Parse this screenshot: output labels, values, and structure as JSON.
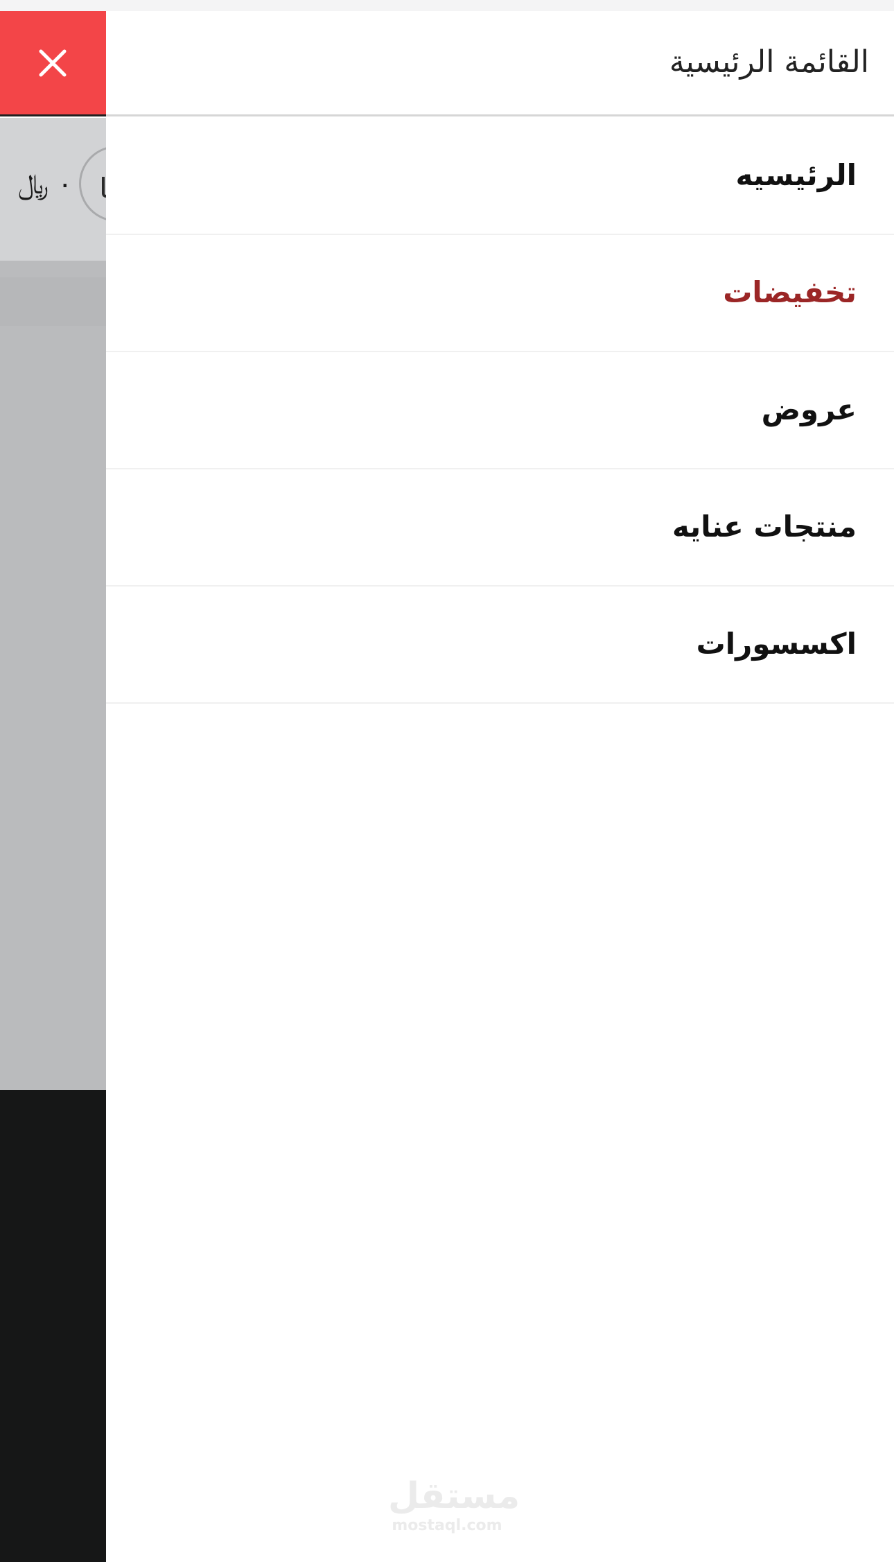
{
  "drawer": {
    "title": "القائمة الرئيسية",
    "close_icon": "close-icon",
    "close_color": "#f34548",
    "items": [
      {
        "label": "الرئيسيه",
        "highlighted": false
      },
      {
        "label": "تخفيضات",
        "highlighted": true
      },
      {
        "label": "عروض",
        "highlighted": false
      },
      {
        "label": "منتجات عنايه",
        "highlighted": false
      },
      {
        "label": "اكسسورات",
        "highlighted": false
      }
    ],
    "highlight_color": "#9b2626"
  },
  "background": {
    "cart_amount": "٠ ﷼",
    "cart_icon": "cart-icon"
  },
  "watermark": {
    "arabic": "مستقل",
    "latin": "mostaql.com"
  }
}
